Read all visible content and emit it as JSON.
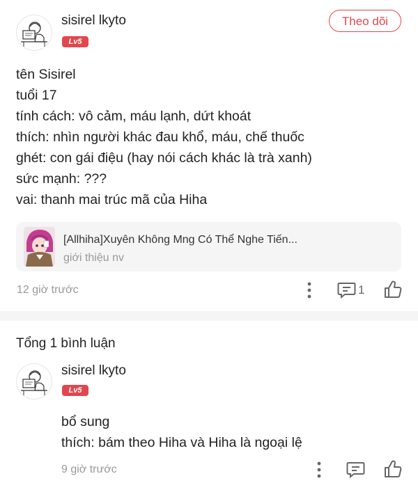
{
  "post": {
    "author": {
      "name": "sisirel lkyto",
      "level": "Lv5"
    },
    "follow_label": "Theo dõi",
    "lines": [
      "tên Sisirel",
      "tuổi 17",
      "tính cách: vô cảm, máu lạnh, dứt khoát",
      "thích: nhìn người khác đau khổ, máu, chế thuốc",
      "ghét: con gái điệu (hay nói cách khác là trà xanh)",
      "sức mạnh: ???",
      "vai: thanh mai trúc mã của Hiha"
    ],
    "linked_story": {
      "title": "[Allhiha]Xuyên Không Mng Có Thể Nghe Tiến...",
      "subtitle": "giới thiệu nv"
    },
    "time": "12 giờ trước",
    "comment_count": "1"
  },
  "comments_section": {
    "title": "Tổng 1 bình luận",
    "comments": [
      {
        "author": {
          "name": "sisirel lkyto",
          "level": "Lv5"
        },
        "lines": [
          "bổ sung",
          "thích: bám theo Hiha và Hiha là ngoại lệ"
        ],
        "time": "9 giờ trước"
      }
    ]
  },
  "icons": {
    "more": "more-vertical-icon",
    "comment": "comment-icon",
    "like": "thumbs-up-icon",
    "avatar": "sketch-avatar-icon",
    "story_cover": "anime-character-cover"
  },
  "colors": {
    "accent": "#e2474e",
    "muted_text": "#999999",
    "card_bg": "#f5f5f5",
    "icon_gray": "#666666"
  }
}
